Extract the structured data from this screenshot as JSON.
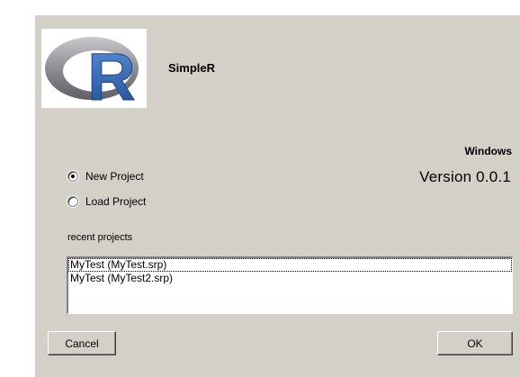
{
  "app": {
    "name": "SimpleR",
    "logo_letter": "R",
    "platform": "Windows",
    "version": "Version 0.0.1"
  },
  "options": {
    "new_project": {
      "label": "New Project",
      "checked": true
    },
    "load_project": {
      "label": "Load Project",
      "checked": false
    }
  },
  "recent": {
    "label": "recent projects",
    "items": [
      "MyTest (MyTest.srp)",
      "MyTest (MyTest2.srp)"
    ]
  },
  "buttons": {
    "cancel": "Cancel",
    "ok": "OK"
  },
  "colors": {
    "dialog_bg": "#d4d0c8",
    "logo_ring": "#8e8e94",
    "logo_letter": "#2d5fa8"
  }
}
